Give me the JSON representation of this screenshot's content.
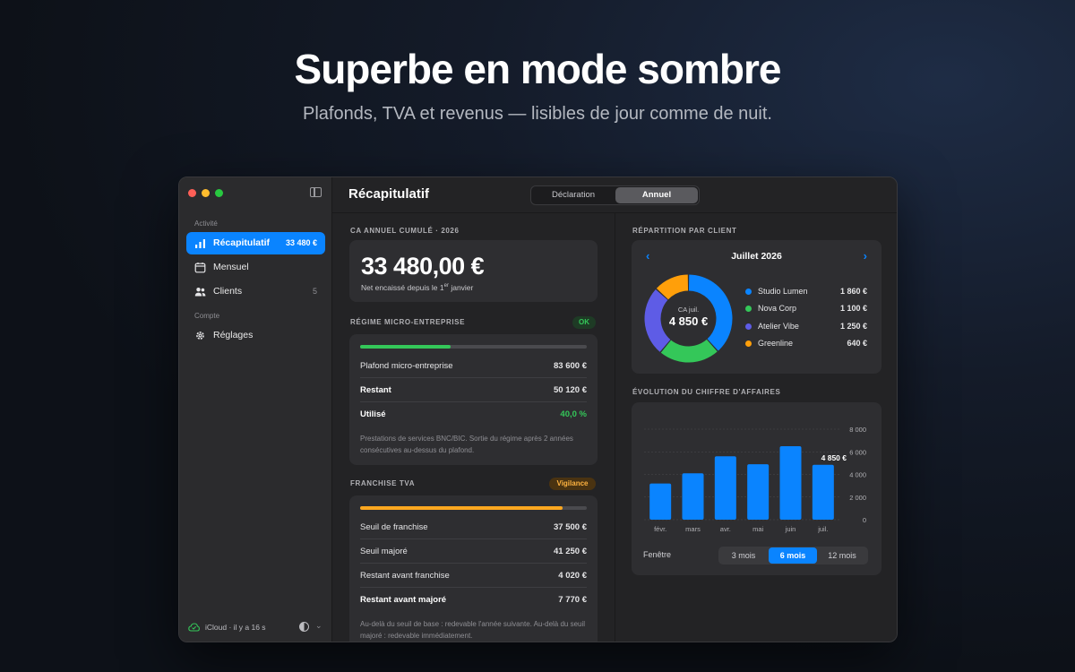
{
  "hero": {
    "title": "Superbe en mode sombre",
    "subtitle": "Plafonds, TVA et revenus — lisibles de jour comme de nuit."
  },
  "sidebar": {
    "section_activity": "Activité",
    "section_account": "Compte",
    "items": [
      {
        "label": "Récapitulatif",
        "count": "33 480 €",
        "icon": "bar-chart-icon",
        "active": true
      },
      {
        "label": "Mensuel",
        "count": "",
        "icon": "calendar-icon",
        "active": false
      },
      {
        "label": "Clients",
        "count": "5",
        "icon": "people-icon",
        "active": false
      },
      {
        "label": "Réglages",
        "count": "",
        "icon": "gear-icon",
        "active": false
      }
    ],
    "footer": {
      "sync": "iCloud · il y a 16 s",
      "icon": "cloud-check-icon"
    }
  },
  "toolbar": {
    "title": "Récapitulatif",
    "segments": [
      "Déclaration",
      "Annuel"
    ],
    "selected": "Annuel"
  },
  "annual": {
    "header": "CA ANNUEL CUMULÉ · 2026",
    "amount": "33 480,00 €",
    "subtitle": "Net encaissé depuis le 1er janvier"
  },
  "micro": {
    "header": "RÉGIME MICRO-ENTREPRISE",
    "badge": "OK",
    "progress": 0.4,
    "rows": [
      {
        "label": "Plafond micro-entreprise",
        "value": "83 600 €"
      },
      {
        "label": "Restant",
        "value": "50 120 €"
      },
      {
        "label": "Utilisé",
        "value": "40,0 %"
      }
    ],
    "note": "Prestations de services BNC/BIC. Sortie du régime après 2 années consécutives au-dessus du plafond."
  },
  "tva": {
    "header": "FRANCHISE TVA",
    "badge": "Vigilance",
    "progress": 0.893,
    "rows": [
      {
        "label": "Seuil de franchise",
        "value": "37 500 €"
      },
      {
        "label": "Seuil majoré",
        "value": "41 250 €"
      },
      {
        "label": "Restant avant franchise",
        "value": "4 020 €"
      },
      {
        "label": "Restant avant majoré",
        "value": "7 770 €"
      }
    ],
    "note": "Au-delà du seuil de base : redevable l'année suivante. Au-delà du seuil majoré : redevable immédiatement."
  },
  "repartition": {
    "header": "RÉPARTITION PAR CLIENT",
    "month": "Juillet 2026",
    "center_label": "CA juil.",
    "center_value": "4 850 €"
  },
  "evolution": {
    "header": "ÉVOLUTION DU CHIFFRE D'AFFAIRES",
    "window_label": "Fenêtre",
    "tabs": [
      "3 mois",
      "6 mois",
      "12 mois"
    ],
    "selected_tab": "6 mois",
    "highlight_label": "4 850 €"
  },
  "colors": {
    "accent": "#0a84ff",
    "green": "#34c759",
    "purple": "#5e5ce6",
    "orange": "#ff9f0a",
    "tva_bar": "#ffa81f"
  },
  "chart_data": [
    {
      "type": "pie",
      "title": "Juillet 2026",
      "categories": [
        "Studio Lumen",
        "Nova Corp",
        "Atelier Vibe",
        "Greenline"
      ],
      "values": [
        1860,
        1100,
        1250,
        640
      ],
      "value_labels": [
        "1 860 €",
        "1 100 €",
        "1 250 €",
        "640 €"
      ],
      "colors": [
        "#0a84ff",
        "#34c759",
        "#5e5ce6",
        "#ff9f0a"
      ]
    },
    {
      "type": "bar",
      "title": "",
      "categories": [
        "févr.",
        "mars",
        "avr.",
        "mai",
        "juin",
        "juil."
      ],
      "values": [
        3200,
        4100,
        5600,
        4900,
        6500,
        4850
      ],
      "ylim": [
        0,
        8000
      ],
      "yticks": [
        0,
        2000,
        4000,
        6000,
        8000
      ],
      "ytick_labels": [
        "0",
        "2 000",
        "4 000",
        "6 000",
        "8 000"
      ],
      "grid": true,
      "color": "#0a84ff"
    }
  ]
}
